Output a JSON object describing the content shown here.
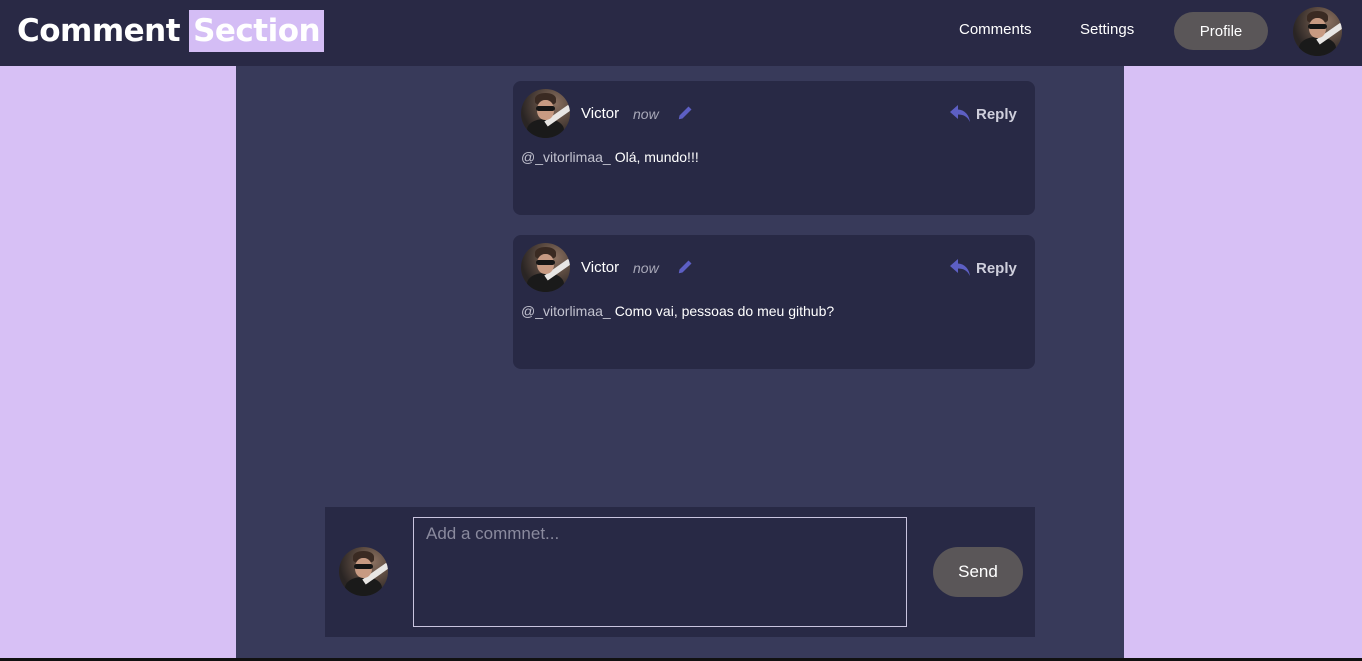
{
  "header": {
    "brand_part1": "Comment",
    "brand_part2": "Section",
    "nav": [
      "Comments",
      "Settings"
    ],
    "profile_label": "Profile"
  },
  "comments": [
    {
      "author": "Victor",
      "time": "now",
      "mention": "@_vitorlimaa_",
      "text": "Olá, mundo!!!",
      "reply_label": "Reply"
    },
    {
      "author": "Victor",
      "time": "now",
      "mention": "@_vitorlimaa_",
      "text": "Como vai, pessoas do meu github?",
      "reply_label": "Reply"
    }
  ],
  "composer": {
    "placeholder": "Add a commnet...",
    "send_label": "Send"
  },
  "colors": {
    "page_bg": "#d7c0f5",
    "header_bg": "#292945",
    "main_bg": "#383a5a",
    "card_bg": "#282945",
    "accent": "#5d5fc4"
  },
  "icons": [
    "avatar",
    "pencil-icon",
    "reply-arrow-icon"
  ]
}
